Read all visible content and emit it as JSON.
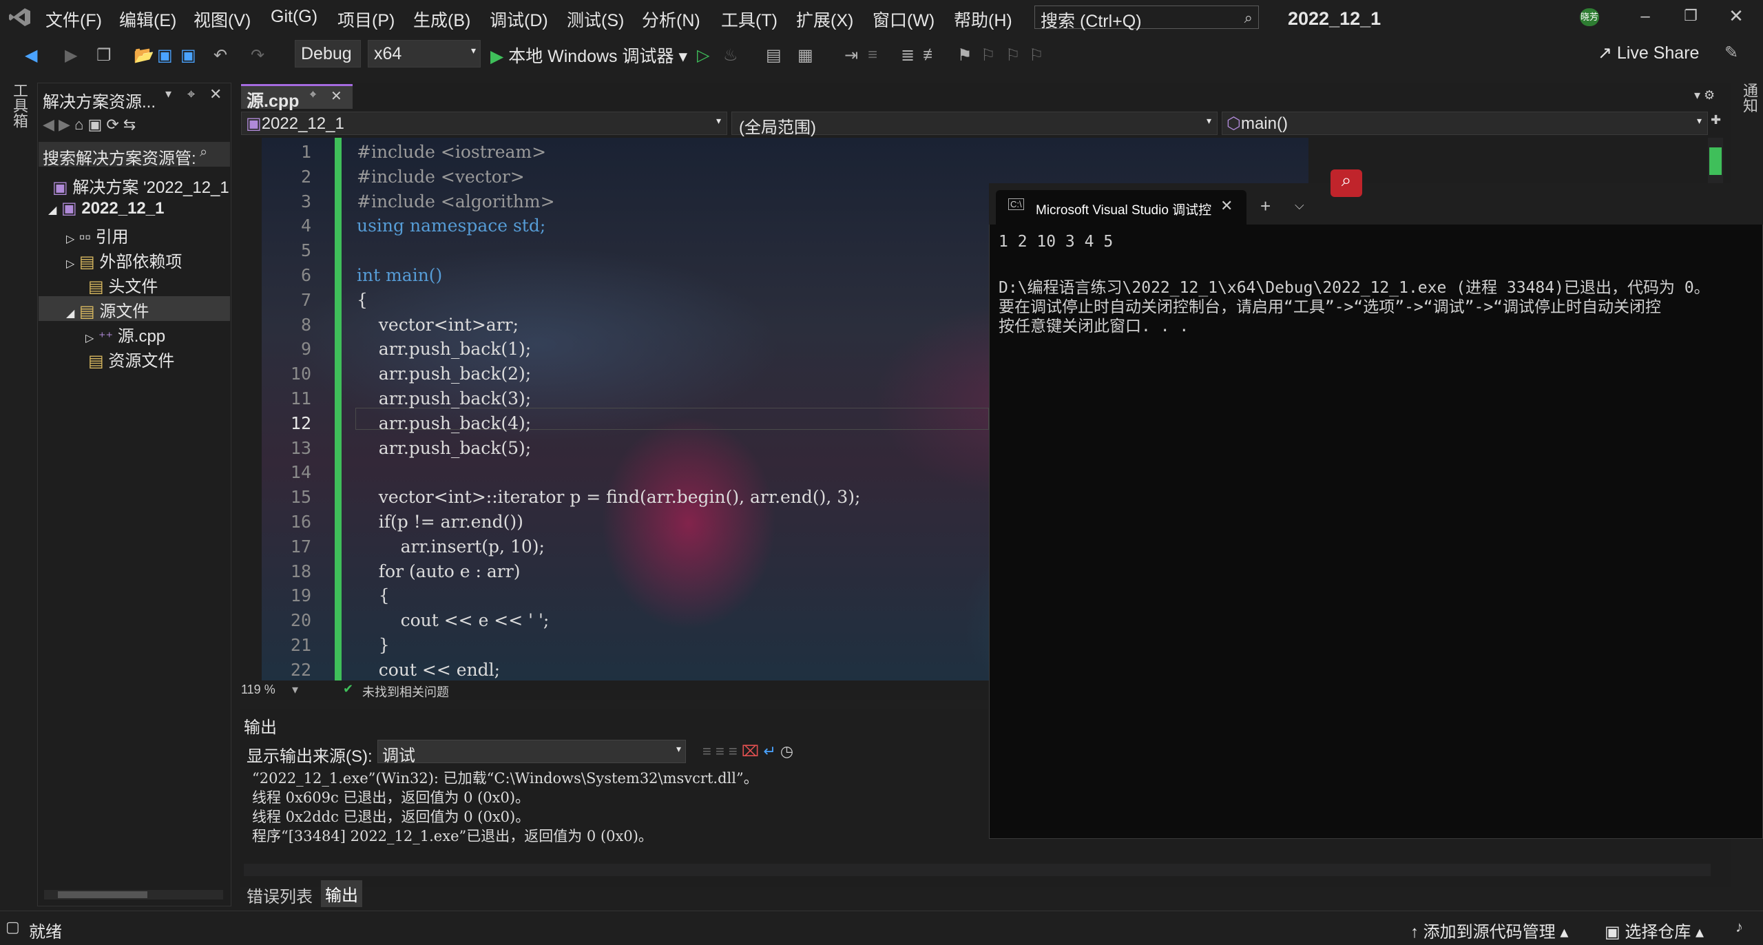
{
  "menu": [
    "文件(F)",
    "编辑(E)",
    "视图(V)",
    "Git(G)",
    "项目(P)",
    "生成(B)",
    "调试(D)",
    "测试(S)",
    "分析(N)",
    "工具(T)",
    "扩展(X)",
    "窗口(W)",
    "帮助(H)"
  ],
  "search": {
    "label": "搜索 (Ctrl+Q)"
  },
  "title": "2022_12_1",
  "user_badge": "晓芳",
  "toolbar": {
    "config": "Debug",
    "platform": "x64",
    "run_label": "本地 Windows 调试器",
    "live_share": "Live Share"
  },
  "left_rail": {
    "label": "工具箱"
  },
  "right_rail": {
    "label": "通知"
  },
  "solution_explorer": {
    "title": "解决方案资源...",
    "search_placeholder": "搜索解决方案资源管:",
    "items": [
      "解决方案 '2022_12_1",
      "2022_12_1",
      "引用",
      "外部依赖项",
      "头文件",
      "源文件",
      "源.cpp",
      "资源文件"
    ]
  },
  "editor": {
    "tab": "源.cpp",
    "nav_project": "2022_12_1",
    "nav_scope": "(全局范围)",
    "nav_member": "main()",
    "line_numbers": [
      "1",
      "2",
      "3",
      "4",
      "5",
      "6",
      "7",
      "8",
      "9",
      "10",
      "11",
      "12",
      "13",
      "14",
      "15",
      "16",
      "17",
      "18",
      "19",
      "20",
      "21",
      "22"
    ],
    "lines": [
      "#include <iostream>",
      "#include <vector>",
      "#include <algorithm>",
      "using namespace std;",
      "",
      "int main()",
      "{",
      "    vector<int>arr;",
      "    arr.push_back(1);",
      "    arr.push_back(2);",
      "    arr.push_back(3);",
      "    arr.push_back(4);",
      "    arr.push_back(5);",
      "",
      "    vector<int>::iterator p = find(arr.begin(), arr.end(), 3);",
      "    if(p != arr.end())",
      "        arr.insert(p, 10);",
      "    for (auto e : arr)",
      "    {",
      "        cout << e << ' ';",
      "    }",
      "    cout << endl;"
    ],
    "zoom": "119 %",
    "issues": "未找到相关问题"
  },
  "console": {
    "tab": "Microsoft Visual Studio 调试控",
    "lines": [
      "1 2 10 3 4 5",
      "",
      "D:\\编程语言练习\\2022_12_1\\x64\\Debug\\2022_12_1.exe (进程 33484)已退出，代码为 0。",
      "要在调试停止时自动关闭控制台，请启用“工具”->“选项”->“调试”->“调试停止时自动关闭控",
      "按任意键关闭此窗口. . ."
    ]
  },
  "output": {
    "title": "输出",
    "source_label": "显示输出来源(S):",
    "source_value": "调试",
    "lines": [
      "“2022_12_1.exe”(Win32): 已加载“C:\\Windows\\System32\\msvcrt.dll”。",
      "线程 0x609c 已退出，返回值为 0 (0x0)。",
      "线程 0x2ddc 已退出，返回值为 0 (0x0)。",
      "程序“[33484] 2022_12_1.exe”已退出，返回值为 0 (0x0)。"
    ],
    "tabs": [
      "错误列表",
      "输出"
    ]
  },
  "status": {
    "ready": "就绪",
    "source_control": "添加到源代码管理",
    "repo": "选择仓库"
  }
}
